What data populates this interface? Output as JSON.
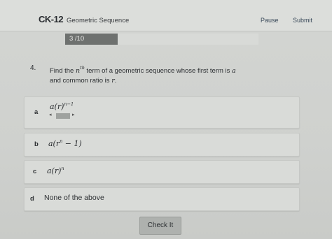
{
  "header": {
    "logo": "CK-12",
    "title": "Geometric Sequence",
    "pause_label": "Pause",
    "submit_label": "Submit"
  },
  "progress": {
    "text": "3 /10",
    "value": 3,
    "max": 10
  },
  "question": {
    "number": "4.",
    "text_before": "Find the ",
    "n": "n",
    "th": "th",
    "text_middle": " term of a geometric sequence whose first term is ",
    "a": "a",
    "text_line2": "and common ratio is ",
    "r": "r",
    "period": "."
  },
  "options": [
    {
      "letter": "a",
      "expr_main": "a(r)",
      "expr_sup": "n−1"
    },
    {
      "letter": "b",
      "expr_main": "a(r",
      "expr_sup": "n",
      "expr_tail": " − 1)"
    },
    {
      "letter": "c",
      "expr_main": "a(r)",
      "expr_sup": "n"
    },
    {
      "letter": "d",
      "text": "None of the above"
    }
  ],
  "check_label": "Check It"
}
